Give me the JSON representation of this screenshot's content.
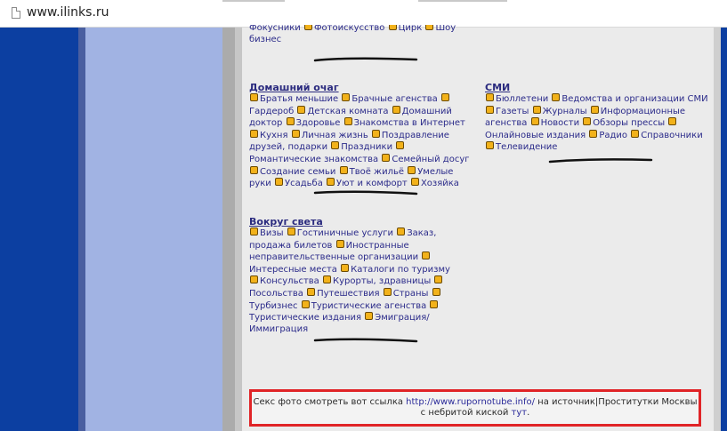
{
  "browser": {
    "url": "www.ilinks.ru"
  },
  "top_fragment": {
    "items": [
      "Фокусники",
      "Фотоискусство",
      "Цирк",
      "Шоу бизнес"
    ]
  },
  "categories": {
    "home": {
      "title": "Домашний очаг",
      "items": [
        "Братья меньшие",
        "Брачные агенства",
        "Гардероб",
        "Детская комната",
        "Домашний доктор",
        "Здоровье",
        "Знакомства в Интернет",
        "Кухня",
        "Личная жизнь",
        "Поздравление друзей, подарки",
        "Праздники",
        "Романтические знакомства",
        "Семейный досуг",
        "Создание семьи",
        "Твоё жильё",
        "Умелые руки",
        "Усадьба",
        "Уют и комфорт",
        "Хозяйка"
      ]
    },
    "smi": {
      "title": "СМИ",
      "items": [
        "Бюллетени",
        "Ведомства и организации СМИ",
        "Газеты",
        "Журналы",
        "Информационные агенства",
        "Новости",
        "Обзоры прессы",
        "Онлайновые издания",
        "Радио",
        "Справочники",
        "Телевидение"
      ]
    },
    "travel": {
      "title": "Вокруг света",
      "items": [
        "Визы",
        "Гостиничные услуги",
        "Заказ, продажа билетов",
        "Иностранные неправительственные организации",
        "Интересные места",
        "Каталоги по туризму",
        "Консульства",
        "Курорты, здравницы",
        "Посольства",
        "Путешествия",
        "Страны",
        "Турбизнес",
        "Туристические агенства",
        "Туристические издания",
        "Эмиграция/ Иммиграция"
      ]
    }
  },
  "ad": {
    "text_before": "Секс фото смотреть вот ссылка ",
    "link1": "http://www.rupornotube.info/",
    "text_mid": " на источник|Проститутки Москвы с небритой киской ",
    "link2": "тут",
    "text_end": "."
  },
  "colors": {
    "dark_blue": "#0c3fa1",
    "light_blue": "#a1b3e3",
    "content_bg": "#ebebeb",
    "link": "#2b2b8a",
    "bullet": "#f2b21a",
    "ad_border": "#e02427"
  }
}
